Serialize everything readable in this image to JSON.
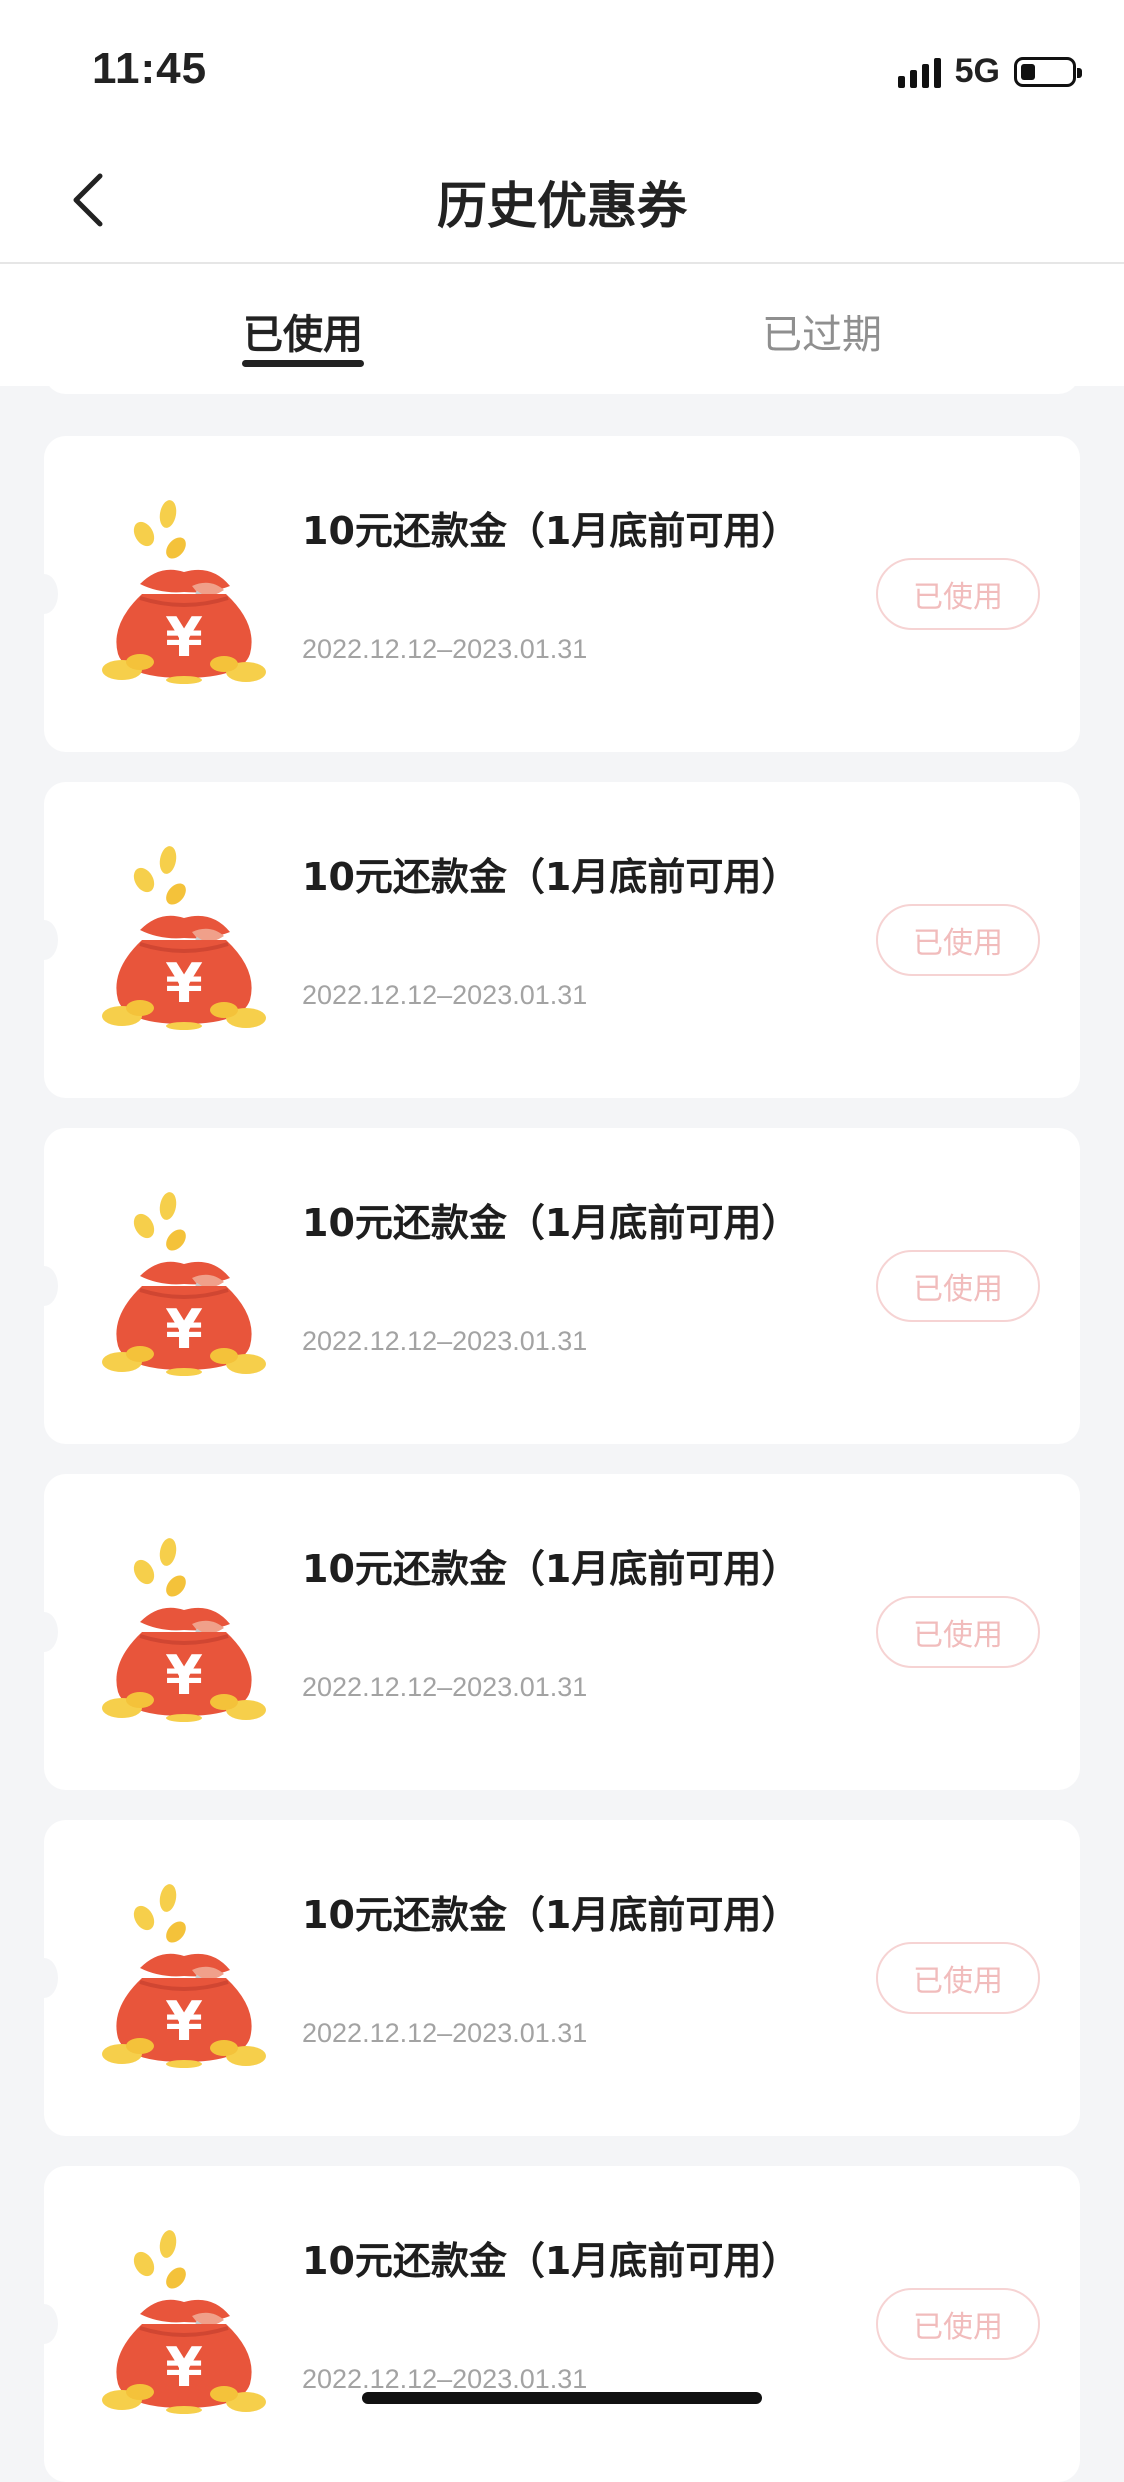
{
  "status_bar": {
    "time": "11:45",
    "network": "5G",
    "battery_level": 0.25
  },
  "header": {
    "title": "历史优惠券",
    "back_icon": "chevron-left-icon"
  },
  "tabs": [
    {
      "label": "已使用",
      "active": true
    },
    {
      "label": "已过期",
      "active": false
    }
  ],
  "coupons": [
    {
      "title": "10元还款金（1月底前可用）",
      "date": "2022.12.12–2023.01.31",
      "status": "已使用",
      "icon": "money-bag-icon"
    },
    {
      "title": "10元还款金（1月底前可用）",
      "date": "2022.12.12–2023.01.31",
      "status": "已使用",
      "icon": "money-bag-icon"
    },
    {
      "title": "10元还款金（1月底前可用）",
      "date": "2022.12.12–2023.01.31",
      "status": "已使用",
      "icon": "money-bag-icon"
    },
    {
      "title": "10元还款金（1月底前可用）",
      "date": "2022.12.12–2023.01.31",
      "status": "已使用",
      "icon": "money-bag-icon"
    },
    {
      "title": "10元还款金（1月底前可用）",
      "date": "2022.12.12–2023.01.31",
      "status": "已使用",
      "icon": "money-bag-icon"
    },
    {
      "title": "10元还款金（1月底前可用）",
      "date": "2022.12.12–2023.01.31",
      "status": "已使用",
      "icon": "money-bag-icon"
    }
  ],
  "colors": {
    "accent": "#e8553b",
    "used_border": "#f6d3d3",
    "used_text": "#f1bcbc",
    "gold": "#f6cf4b",
    "background": "#f4f5f7"
  }
}
